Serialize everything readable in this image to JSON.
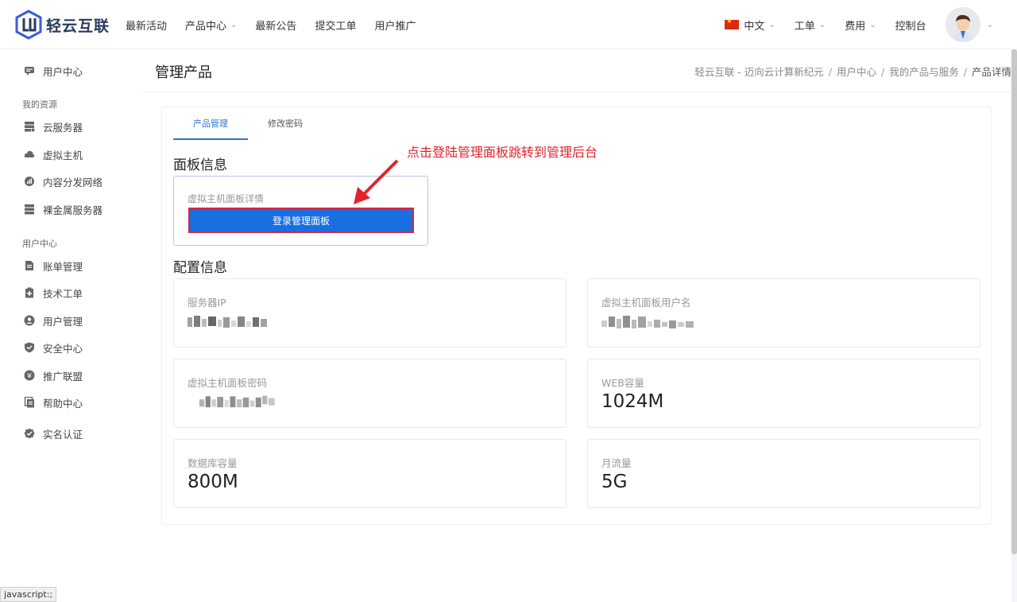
{
  "header": {
    "brand": "轻云互联",
    "nav": [
      "最新活动",
      "产品中心",
      "最新公告",
      "提交工单",
      "用户推广"
    ],
    "lang": "中文",
    "ticket": "工单",
    "fee": "费用",
    "console": "控制台"
  },
  "sidebar": {
    "user_center": "用户中心",
    "group_resources": "我的资源",
    "resources": [
      "云服务器",
      "虚拟主机",
      "内容分发网络",
      "裸金属服务器"
    ],
    "group_user": "用户中心",
    "user_items": [
      "账单管理",
      "技术工单",
      "用户管理",
      "安全中心",
      "推广联盟",
      "帮助中心",
      "实名认证"
    ]
  },
  "page": {
    "title": "管理产品",
    "breadcrumb": [
      "轻云互联 - 迈向云计算新纪元",
      "用户中心",
      "我的产品与服务",
      "产品详情"
    ]
  },
  "tabs": [
    "产品管理",
    "修改密码"
  ],
  "panel": {
    "title": "面板信息",
    "label": "虚拟主机面板详情",
    "button": "登录管理面板"
  },
  "annotation": "点击登陆管理面板跳转到管理后台",
  "config": {
    "title": "配置信息",
    "server_ip_label": "服务器IP",
    "username_label": "虚拟主机面板用户名",
    "password_label": "虚拟主机面板密码",
    "web_label": "WEB容量",
    "web_value": "1024M",
    "db_label": "数据库容量",
    "db_value": "800M",
    "traffic_label": "月流量",
    "traffic_value": "5G"
  },
  "status_bar": "javascript:;",
  "colors": {
    "accent": "#2b74d8",
    "button": "#1a6fe0",
    "annotation": "#e3222b"
  }
}
